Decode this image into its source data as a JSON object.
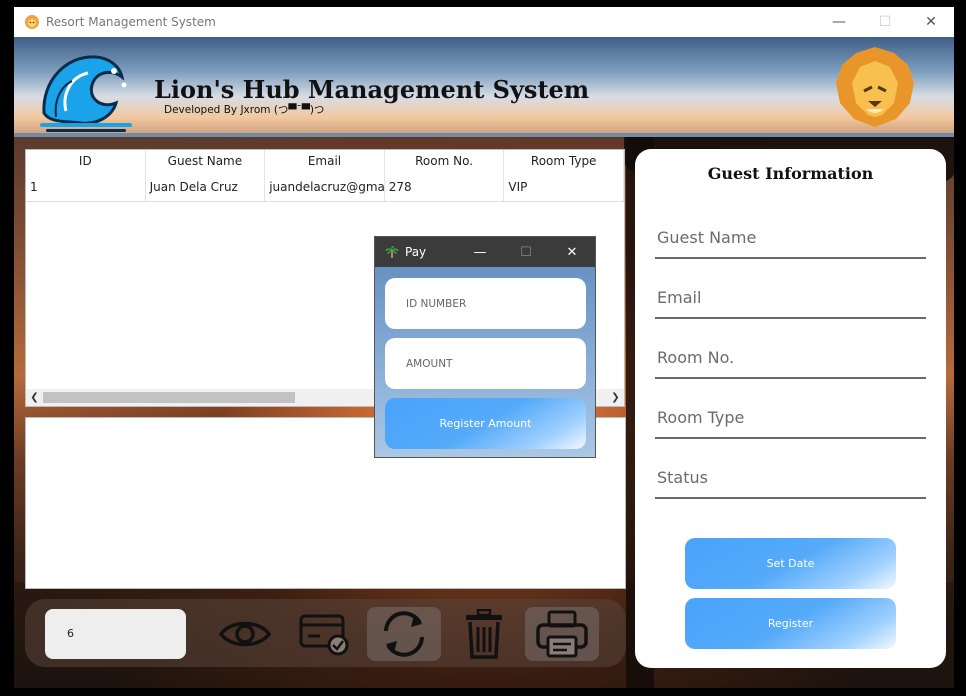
{
  "window": {
    "title": "Resort Management System"
  },
  "header": {
    "title": "Lion's Hub Management System",
    "subtitle": "Developed By Jxrom (つ▀¯▀)つ"
  },
  "table": {
    "columns": [
      "ID",
      "Guest Name",
      "Email",
      "Room No.",
      "Room Type"
    ],
    "rows": [
      [
        "1",
        "Juan Dela Cruz",
        "juandelacruz@gma...",
        "278",
        "VIP"
      ]
    ]
  },
  "guest_info": {
    "title": "Guest Information",
    "fields": [
      {
        "placeholder": "Guest Name",
        "value": ""
      },
      {
        "placeholder": "Email",
        "value": ""
      },
      {
        "placeholder": "Room No.",
        "value": ""
      },
      {
        "placeholder": "Room Type",
        "value": ""
      },
      {
        "placeholder": "Status",
        "value": ""
      }
    ],
    "set_date_label": "Set Date",
    "register_label": "Register"
  },
  "toolbar": {
    "count": "6",
    "icons": [
      "eye-icon",
      "card-check-icon",
      "refresh-icon",
      "trash-icon",
      "printer-icon"
    ]
  },
  "pay_dialog": {
    "title": "Pay",
    "id_placeholder": "ID NUMBER",
    "amount_placeholder": "AMOUNT",
    "register_label": "Register Amount"
  },
  "colors": {
    "accent": "#49a3fb",
    "dialog_bar": "#3b3b3b"
  }
}
